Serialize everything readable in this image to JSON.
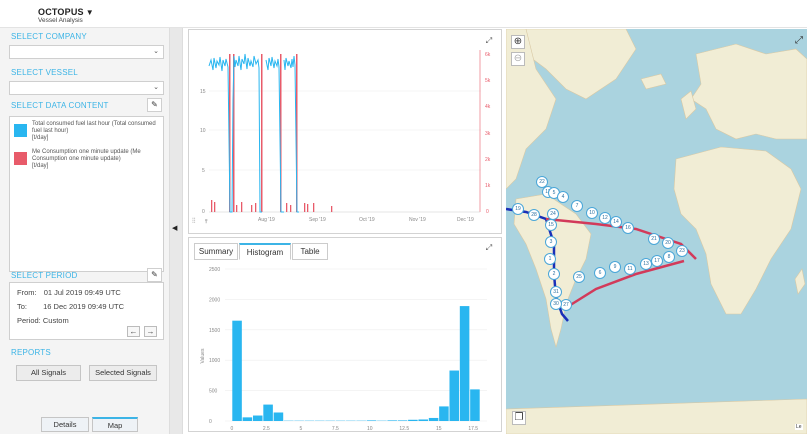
{
  "header": {
    "app_name": "OCTOPUS",
    "subtitle": "Vessel Analysis"
  },
  "left": {
    "company_title": "SELECT COMPANY",
    "company_value": "",
    "vessel_title": "SELECT VESSEL",
    "vessel_value": "",
    "data_content_title": "SELECT DATA CONTENT",
    "signals": [
      {
        "label": "Total consumed fuel last hour (Total consumed fuel last hour)",
        "unit": "[t/day]",
        "color": "#29b6f0"
      },
      {
        "label": "Me Consumption one minute update (Me Consumption one minute update)",
        "unit": "[t/day]",
        "color": "#e85b6a"
      }
    ],
    "period_title": "SELECT PERIOD",
    "period": {
      "from_label": "From:",
      "from_value": "01 Jul 2019  09:49 UTC",
      "to_label": "To:",
      "to_value": "16 Dec 2019  09:49 UTC",
      "period_label": "Period:",
      "period_value": "Custom"
    },
    "reports_title": "REPORTS",
    "all_signals": "All Signals",
    "selected_signals": "Selected Signals",
    "details": "Details",
    "map": "Map"
  },
  "top_chart": {
    "left_ticks": [
      "15",
      "10",
      "5",
      "0"
    ],
    "right_ticks": [
      "6k",
      "5k",
      "4k",
      "3k",
      "2k",
      "1k",
      "0"
    ],
    "x_ticks": [
      "Aug '19",
      "Sep '19",
      "Oct '19",
      "Nov '19",
      "Dec '19"
    ]
  },
  "tabs": [
    "Summary",
    "Histogram",
    "Table"
  ],
  "active_tab": "Histogram",
  "chart_data": {
    "type": "bar",
    "title": "",
    "xlabel": "",
    "ylabel": "Values",
    "ylim": [
      0,
      2500
    ],
    "yticks": [
      "2500",
      "2000",
      "1500",
      "1000",
      "500",
      "0"
    ],
    "xticks": [
      "0",
      "2.5",
      "5",
      "7.5",
      "10",
      "12.5",
      "15",
      "17.5"
    ],
    "bin_width": 0.75,
    "bins": [
      0,
      0.75,
      1.5,
      2.25,
      3.0,
      3.75,
      4.5,
      5.25,
      6.0,
      6.75,
      7.5,
      8.25,
      9.0,
      9.75,
      10.5,
      11.25,
      12.0,
      12.75,
      13.5,
      14.25,
      15.0,
      15.75,
      16.5,
      17.25,
      18.0
    ],
    "values": [
      1650,
      60,
      90,
      270,
      140,
      5,
      5,
      5,
      5,
      5,
      5,
      5,
      5,
      10,
      5,
      10,
      10,
      20,
      25,
      50,
      240,
      830,
      1890,
      520
    ],
    "color": "#29b6f0"
  },
  "map": {
    "ports": [
      "22",
      "18",
      "5",
      "4",
      "7",
      "10",
      "12",
      "14",
      "16",
      "21",
      "20",
      "23",
      "8",
      "17",
      "13",
      "11",
      "9",
      "6",
      "19",
      "28",
      "24",
      "15",
      "3",
      "1",
      "2",
      "31",
      "25",
      "27",
      "30"
    ],
    "route_colors": {
      "blue": "#1a2fb8",
      "red": "#d23a5a"
    },
    "attribution": "Le"
  }
}
